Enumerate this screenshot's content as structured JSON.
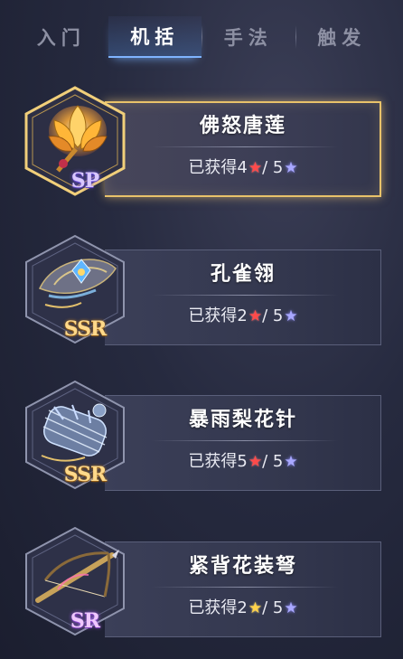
{
  "tabs": [
    {
      "label": "入门",
      "active": false
    },
    {
      "label": "机括",
      "active": true
    },
    {
      "label": "手法",
      "active": false
    },
    {
      "label": "触发",
      "active": false
    }
  ],
  "items": [
    {
      "name": "佛怒唐莲",
      "rarity": "SP",
      "progress_prefix": "已获得",
      "obtained": "4",
      "obtained_star": "red",
      "separator": "/",
      "total": "5",
      "selected": true
    },
    {
      "name": "孔雀翎",
      "rarity": "SSR",
      "progress_prefix": "已获得",
      "obtained": "2",
      "obtained_star": "red",
      "separator": "/",
      "total": "5",
      "selected": false
    },
    {
      "name": "暴雨梨花针",
      "rarity": "SSR",
      "progress_prefix": "已获得",
      "obtained": "5",
      "obtained_star": "red",
      "separator": "/",
      "total": "5",
      "selected": false
    },
    {
      "name": "紧背花装弩",
      "rarity": "SR",
      "progress_prefix": "已获得",
      "obtained": "2",
      "obtained_star": "gold",
      "separator": "/",
      "total": "5",
      "selected": false
    }
  ],
  "colors": {
    "selected_border": "#e8c26a",
    "star_red": "#ff4a4a",
    "star_blue": "#a9a8ff",
    "star_gold": "#ffd24a",
    "tab_active_underline": "#7fb4ff"
  }
}
